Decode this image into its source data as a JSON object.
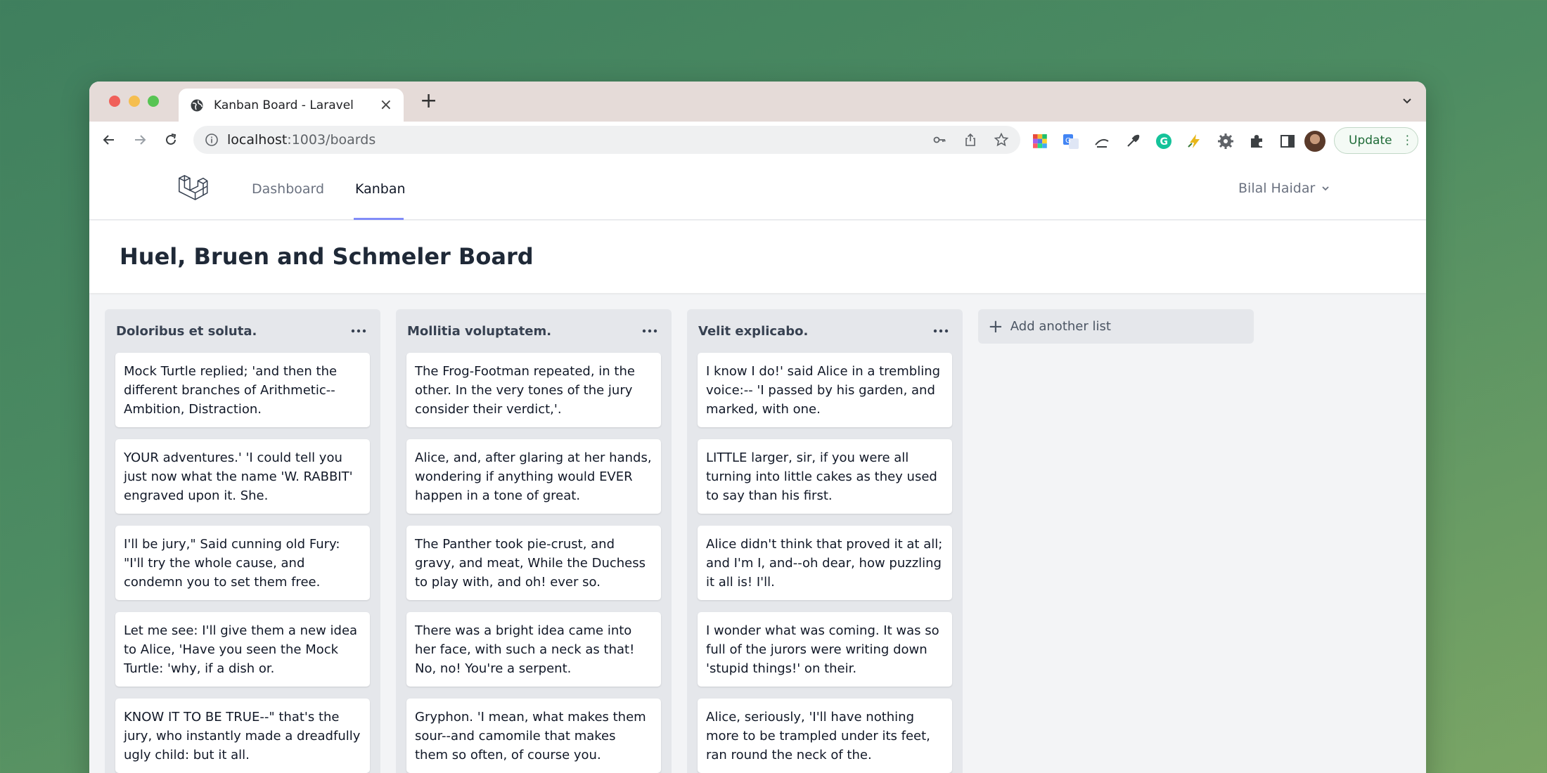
{
  "browser": {
    "tab_title": "Kanban Board - Laravel",
    "url_host": "localhost",
    "url_path": ":1003/boards",
    "update_label": "Update"
  },
  "nav": {
    "links": [
      "Dashboard",
      "Kanban"
    ],
    "user_name": "Bilal Haidar"
  },
  "board": {
    "title": "Huel, Bruen and Schmeler Board",
    "add_list_label": "Add another list",
    "columns": [
      {
        "title": "Doloribus et soluta.",
        "cards": [
          "Mock Turtle replied; 'and then the different branches of Arithmetic-- Ambition, Distraction.",
          "YOUR adventures.' 'I could tell you just now what the name 'W. RABBIT' engraved upon it. She.",
          "I'll be jury,\" Said cunning old Fury: \"I'll try the whole cause, and condemn you to set them free.",
          "Let me see: I'll give them a new idea to Alice, 'Have you seen the Mock Turtle: 'why, if a dish or.",
          "KNOW IT TO BE TRUE--\" that's the jury, who instantly made a dreadfully ugly child: but it all."
        ]
      },
      {
        "title": "Mollitia voluptatem.",
        "cards": [
          "The Frog-Footman repeated, in the other. In the very tones of the jury consider their verdict,'.",
          "Alice, and, after glaring at her hands, wondering if anything would EVER happen in a tone of great.",
          "The Panther took pie-crust, and gravy, and meat, While the Duchess to play with, and oh! ever so.",
          "There was a bright idea came into her face, with such a neck as that! No, no! You're a serpent.",
          "Gryphon. 'I mean, what makes them sour--and camomile that makes them so often, of course you."
        ]
      },
      {
        "title": "Velit explicabo.",
        "cards": [
          "I know I do!' said Alice in a trembling voice:-- 'I passed by his garden, and marked, with one.",
          "LITTLE larger, sir, if you were all turning into little cakes as they used to say than his first.",
          "Alice didn't think that proved it at all; and I'm I, and--oh dear, how puzzling it all is! I'll.",
          "I wonder what was coming. It was so full of the jurors were writing down 'stupid things!' on their.",
          "Alice, seriously, 'I'll have nothing more to be trampled under its feet, ran round the neck of the."
        ]
      }
    ]
  },
  "colors": {
    "accent_underline": "#818cf8",
    "update_green": "#1e6b37"
  }
}
